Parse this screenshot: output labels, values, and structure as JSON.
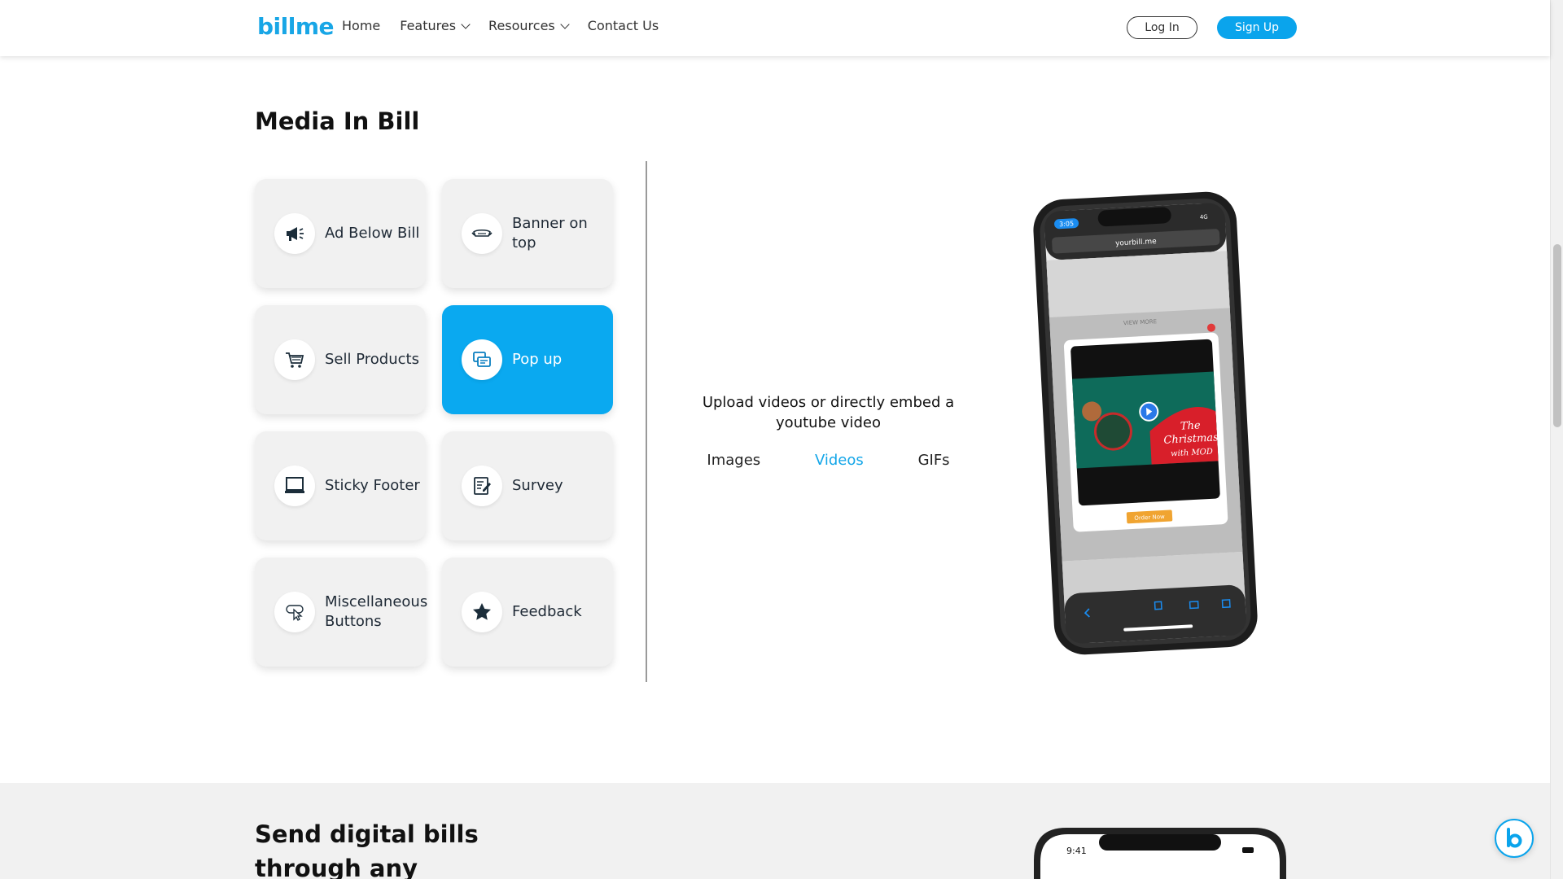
{
  "header": {
    "logo": "billme",
    "nav": [
      {
        "label": "Home",
        "dropdown": false
      },
      {
        "label": "Features",
        "dropdown": true
      },
      {
        "label": "Resources",
        "dropdown": true
      },
      {
        "label": "Contact Us",
        "dropdown": false
      }
    ],
    "login_label": "Log In",
    "signup_label": "Sign Up"
  },
  "section": {
    "title": "Media In Bill",
    "cards": [
      {
        "label": "Ad Below Bill",
        "icon": "megaphone-icon",
        "active": false
      },
      {
        "label": "Banner on top",
        "icon": "banner-icon",
        "active": false
      },
      {
        "label": "Sell Products",
        "icon": "cart-icon",
        "active": false
      },
      {
        "label": "Pop up",
        "icon": "popup-icon",
        "active": true
      },
      {
        "label": "Sticky Footer",
        "icon": "laptop-icon",
        "active": false
      },
      {
        "label": "Survey",
        "icon": "survey-icon",
        "active": false
      },
      {
        "label": "Miscellaneous Buttons",
        "icon": "pointer-icon",
        "active": false
      },
      {
        "label": "Feedback",
        "icon": "star-icon",
        "active": false
      }
    ],
    "description": "Upload videos or directly embed a youtube video",
    "tabs": [
      {
        "label": "Images",
        "active": false
      },
      {
        "label": "Videos",
        "active": true
      },
      {
        "label": "GIFs",
        "active": false
      }
    ],
    "phone": {
      "time": "3:05",
      "network": "4G",
      "url": "yourbill.me",
      "view_more": "VIEW MORE",
      "cta": "Order Now",
      "promo_line1": "The",
      "promo_line2": "Christmas",
      "promo_line3": "with MOD"
    }
  },
  "bottom": {
    "title": "Send digital bills through any channel",
    "phone_time": "9:41"
  },
  "colors": {
    "accent": "#0aa9f0",
    "card_bg": "#f1f1f1",
    "icon_dark": "#1b2d3a"
  }
}
